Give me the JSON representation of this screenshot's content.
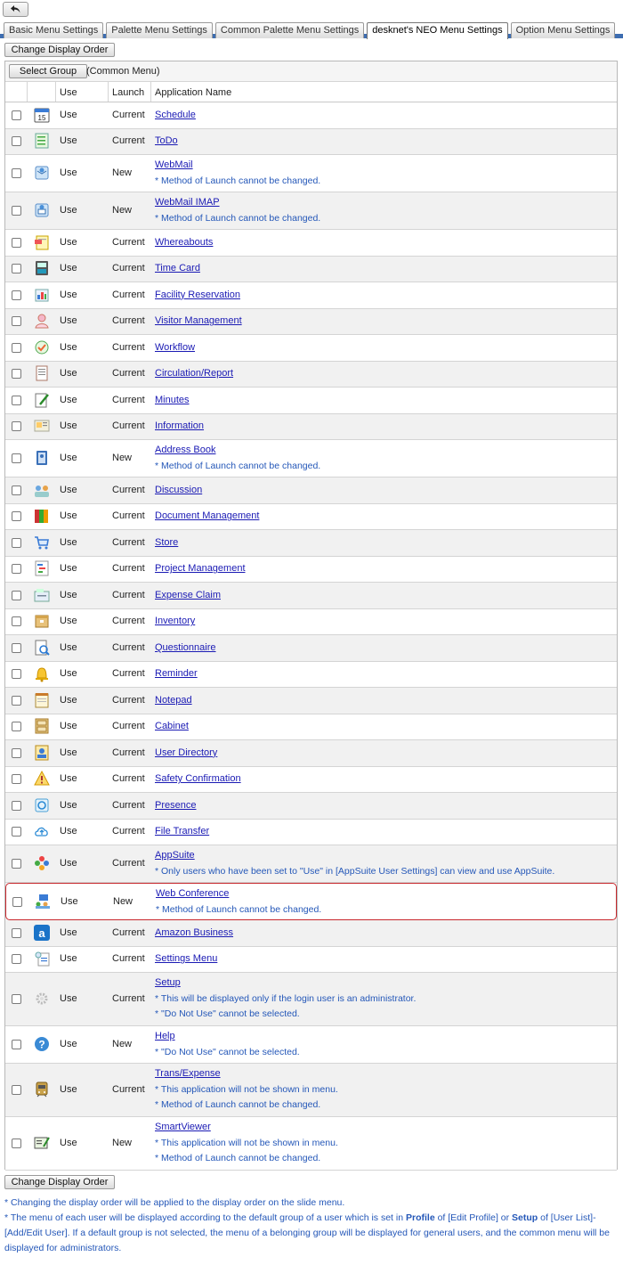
{
  "back_button": {
    "icon": "back-arrow-icon"
  },
  "tabs": [
    {
      "label": "Basic Menu Settings",
      "active": false
    },
    {
      "label": "Palette Menu Settings",
      "active": false
    },
    {
      "label": "Common Palette Menu Settings",
      "active": false
    },
    {
      "label": "desknet's NEO Menu Settings",
      "active": true
    },
    {
      "label": "Option Menu Settings",
      "active": false
    }
  ],
  "change_order_label": "Change Display Order",
  "select_group_label": "Select Group",
  "group_name": "(Common Menu)",
  "columns": {
    "use": "Use",
    "launch": "Launch",
    "app": "Application Name"
  },
  "rows": [
    {
      "icon": "schedule-icon",
      "use": "Use",
      "launch": "Current",
      "name": "Schedule",
      "notes": []
    },
    {
      "icon": "todo-icon",
      "use": "Use",
      "launch": "Current",
      "name": "ToDo",
      "notes": []
    },
    {
      "icon": "webmail-icon",
      "use": "Use",
      "launch": "New",
      "name": "WebMail",
      "notes": [
        "* Method of Launch cannot be changed."
      ]
    },
    {
      "icon": "webmail-imap-icon",
      "use": "Use",
      "launch": "New",
      "name": "WebMail IMAP",
      "notes": [
        "* Method of Launch cannot be changed."
      ]
    },
    {
      "icon": "whereabouts-icon",
      "use": "Use",
      "launch": "Current",
      "name": "Whereabouts",
      "notes": []
    },
    {
      "icon": "time-card-icon",
      "use": "Use",
      "launch": "Current",
      "name": "Time Card",
      "notes": []
    },
    {
      "icon": "facility-reservation-icon",
      "use": "Use",
      "launch": "Current",
      "name": "Facility Reservation",
      "notes": []
    },
    {
      "icon": "visitor-management-icon",
      "use": "Use",
      "launch": "Current",
      "name": "Visitor Management",
      "notes": []
    },
    {
      "icon": "workflow-icon",
      "use": "Use",
      "launch": "Current",
      "name": "Workflow",
      "notes": []
    },
    {
      "icon": "circulation-report-icon",
      "use": "Use",
      "launch": "Current",
      "name": "Circulation/Report",
      "notes": []
    },
    {
      "icon": "minutes-icon",
      "use": "Use",
      "launch": "Current",
      "name": "Minutes",
      "notes": []
    },
    {
      "icon": "information-icon",
      "use": "Use",
      "launch": "Current",
      "name": "Information",
      "notes": []
    },
    {
      "icon": "address-book-icon",
      "use": "Use",
      "launch": "New",
      "name": "Address Book",
      "notes": [
        "* Method of Launch cannot be changed."
      ]
    },
    {
      "icon": "discussion-icon",
      "use": "Use",
      "launch": "Current",
      "name": "Discussion",
      "notes": []
    },
    {
      "icon": "document-management-icon",
      "use": "Use",
      "launch": "Current",
      "name": "Document Management",
      "notes": []
    },
    {
      "icon": "store-cart-icon",
      "use": "Use",
      "launch": "Current",
      "name": "Store",
      "notes": []
    },
    {
      "icon": "project-management-icon",
      "use": "Use",
      "launch": "Current",
      "name": "Project Management",
      "notes": []
    },
    {
      "icon": "expense-claim-icon",
      "use": "Use",
      "launch": "Current",
      "name": "Expense Claim",
      "notes": []
    },
    {
      "icon": "inventory-icon",
      "use": "Use",
      "launch": "Current",
      "name": "Inventory",
      "notes": []
    },
    {
      "icon": "questionnaire-icon",
      "use": "Use",
      "launch": "Current",
      "name": "Questionnaire",
      "notes": []
    },
    {
      "icon": "reminder-bell-icon",
      "use": "Use",
      "launch": "Current",
      "name": "Reminder",
      "notes": []
    },
    {
      "icon": "notepad-icon",
      "use": "Use",
      "launch": "Current",
      "name": "Notepad",
      "notes": []
    },
    {
      "icon": "cabinet-icon",
      "use": "Use",
      "launch": "Current",
      "name": "Cabinet",
      "notes": []
    },
    {
      "icon": "user-directory-icon",
      "use": "Use",
      "launch": "Current",
      "name": "User Directory",
      "notes": []
    },
    {
      "icon": "safety-confirmation-icon",
      "use": "Use",
      "launch": "Current",
      "name": "Safety Confirmation",
      "notes": []
    },
    {
      "icon": "presence-icon",
      "use": "Use",
      "launch": "Current",
      "name": "Presence",
      "notes": []
    },
    {
      "icon": "file-transfer-cloud-icon",
      "use": "Use",
      "launch": "Current",
      "name": "File Transfer",
      "notes": []
    },
    {
      "icon": "appsuite-icon",
      "use": "Use",
      "launch": "Current",
      "name": "AppSuite",
      "notes": [
        "* Only users who have been set to \"Use\" in [AppSuite User Settings] can view and use AppSuite."
      ]
    },
    {
      "icon": "web-conference-icon",
      "use": "Use",
      "launch": "New",
      "name": "Web Conference",
      "notes": [
        "* Method of Launch cannot be changed."
      ],
      "highlight": true
    },
    {
      "icon": "amazon-business-icon",
      "use": "Use",
      "launch": "Current",
      "name": "Amazon Business",
      "notes": []
    },
    {
      "icon": "settings-menu-icon",
      "use": "Use",
      "launch": "Current",
      "name": "Settings Menu",
      "notes": []
    },
    {
      "icon": "setup-gear-icon",
      "use": "Use",
      "launch": "Current",
      "name": "Setup",
      "notes": [
        "* This will be displayed only if the login user is an administrator.",
        "* \"Do Not Use\" cannot be selected."
      ]
    },
    {
      "icon": "help-question-icon",
      "use": "Use",
      "launch": "New",
      "name": "Help",
      "notes": [
        "* \"Do Not Use\" cannot be selected."
      ]
    },
    {
      "icon": "trans-expense-train-icon",
      "use": "Use",
      "launch": "Current",
      "name": "Trans/Expense",
      "notes": [
        "* This application will not be shown in menu.",
        "* Method of Launch cannot be changed."
      ]
    },
    {
      "icon": "smartviewer-icon",
      "use": "Use",
      "launch": "New",
      "name": "SmartViewer",
      "notes": [
        "* This application will not be shown in menu.",
        "* Method of Launch cannot be changed."
      ]
    }
  ],
  "footer_notes": {
    "line1": "* Changing the display order will be applied to the display order on the slide menu.",
    "line2_a": "* The menu of each user will be displayed according to the default group of a user which is set in ",
    "line2_b": "Profile",
    "line2_c": " of [Edit Profile] or ",
    "line2_d": "Setup",
    "line2_e": " of [User List]-[Add/Edit User]. If a default group is not selected, the menu of a belonging group will be displayed for general users, and the common menu will be displayed for administrators."
  },
  "colors": {
    "tab_bar": "#3d6db1",
    "link": "#1a1ab4",
    "note": "#2457b8",
    "highlight": "#c8282d"
  }
}
